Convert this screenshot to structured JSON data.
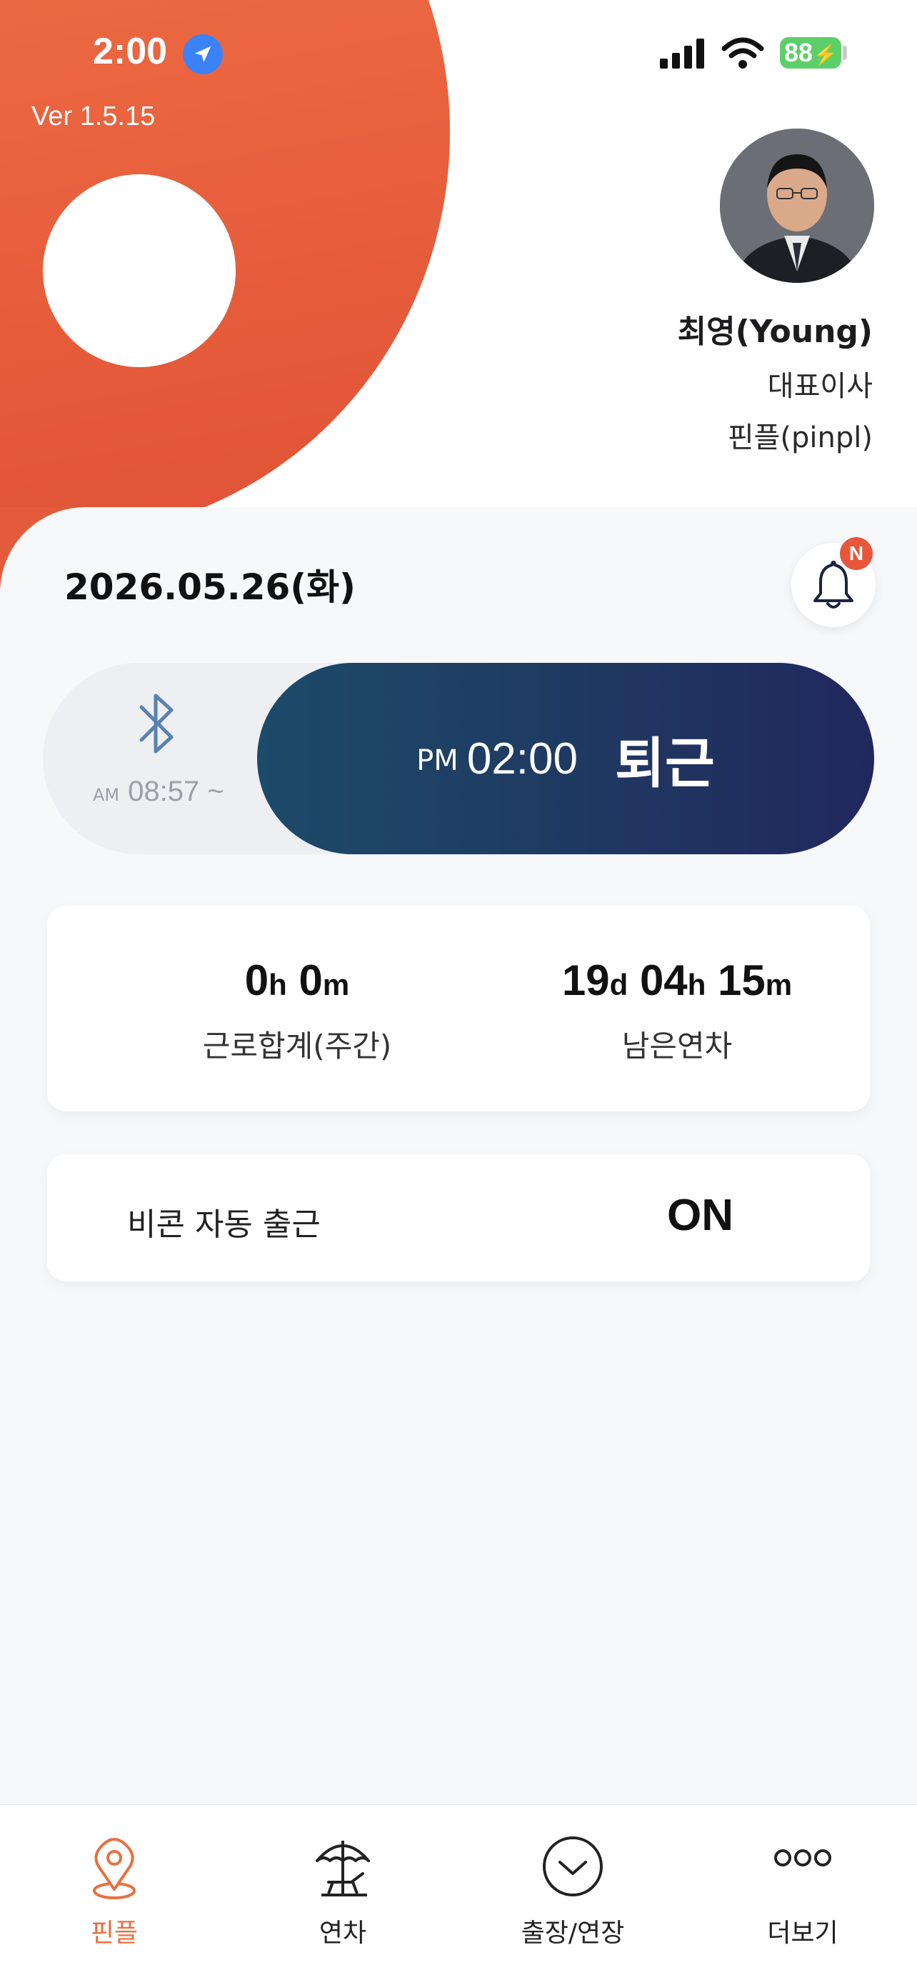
{
  "status_bar": {
    "time": "2:00",
    "battery": "88"
  },
  "app": {
    "version": "Ver 1.5.15",
    "accent": "#e8703f"
  },
  "user": {
    "name": "최영(Young)",
    "title": "대표이사",
    "company": "핀플(pinpl)"
  },
  "date": "2026.05.26(화)",
  "notification": {
    "badge": "N"
  },
  "commute": {
    "checkin_ampm": "AM",
    "checkin_time": "08:57 ~",
    "button_ampm": "PM",
    "button_time": "02:00",
    "button_label": "퇴근"
  },
  "stats": {
    "work_total": {
      "h": "0",
      "h_unit": "h",
      "m": "0",
      "m_unit": "m",
      "label": "근로합계(주간)"
    },
    "leave_left": {
      "d": "19",
      "d_unit": "d",
      "h": "04",
      "h_unit": "h",
      "m": "15",
      "m_unit": "m",
      "label": "남은연차"
    }
  },
  "beacon": {
    "label": "비콘 자동 출근",
    "value": "ON"
  },
  "tabs": [
    {
      "label": "핀플",
      "icon": "map-pin-icon",
      "active": true
    },
    {
      "label": "연차",
      "icon": "beach-umbrella-icon",
      "active": false
    },
    {
      "label": "출장/연장",
      "icon": "check-circle-icon",
      "active": false
    },
    {
      "label": "더보기",
      "icon": "more-dots-icon",
      "active": false
    }
  ]
}
